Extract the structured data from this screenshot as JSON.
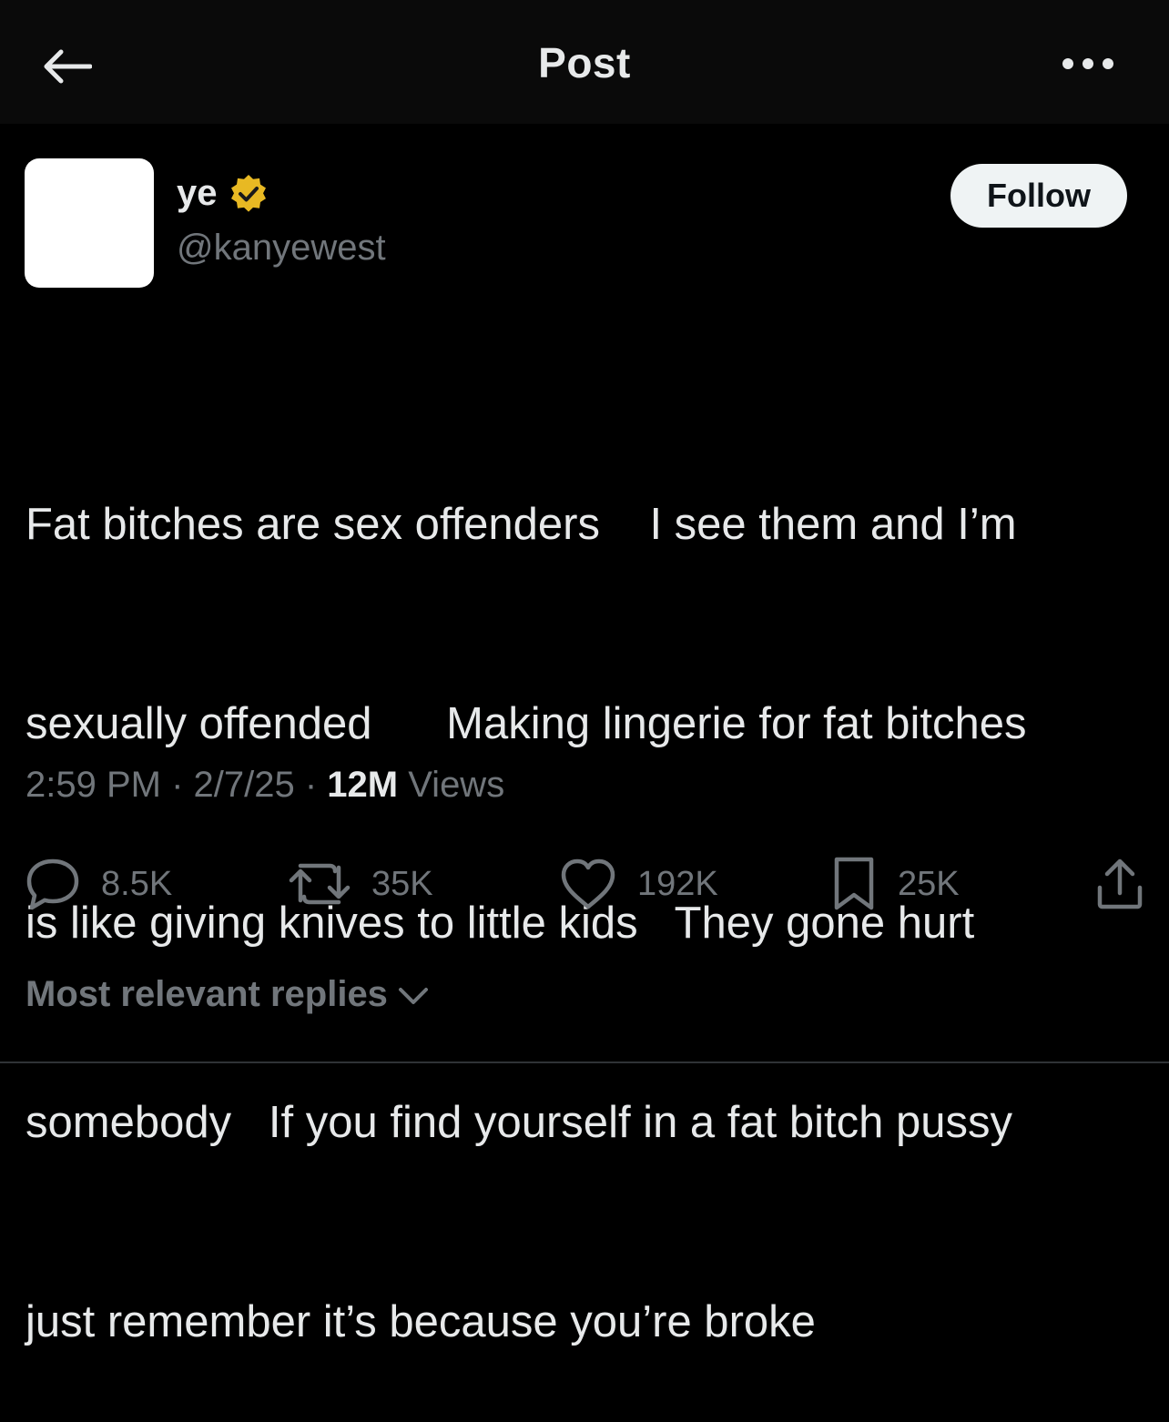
{
  "header": {
    "title": "Post"
  },
  "author": {
    "display_name": "ye",
    "handle": "@kanyewest",
    "verified_badge_color": "#e8b923",
    "follow_label": "Follow"
  },
  "post": {
    "lines": [
      "Fat bitches are sex offenders    I see them and I’m",
      "sexually offended      Making lingerie for fat bitches",
      "is like giving knives to little kids   They gone hurt",
      "somebody   If you find yourself in a fat bitch pussy",
      "just remember it’s because you’re broke"
    ],
    "time": "2:59 PM",
    "date": "2/7/25",
    "separator": " · ",
    "views_count": "12M",
    "views_label": "Views"
  },
  "actions": {
    "replies": "8.5K",
    "reposts": "35K",
    "likes": "192K",
    "bookmarks": "25K"
  },
  "replies_sort": {
    "label": "Most relevant replies"
  },
  "colors": {
    "background": "#000000",
    "header_background": "#0a0a0a",
    "text_primary": "#e7e9ea",
    "text_secondary": "#71767b",
    "follow_button_bg": "#eff3f4"
  },
  "icons": {
    "back": "arrow-left-icon",
    "more": "more-dots-icon",
    "verified": "verified-badge-icon",
    "reply": "reply-bubble-icon",
    "repost": "repost-icon",
    "like": "heart-icon",
    "bookmark": "bookmark-icon",
    "share": "share-icon",
    "chevron": "chevron-down-icon"
  }
}
